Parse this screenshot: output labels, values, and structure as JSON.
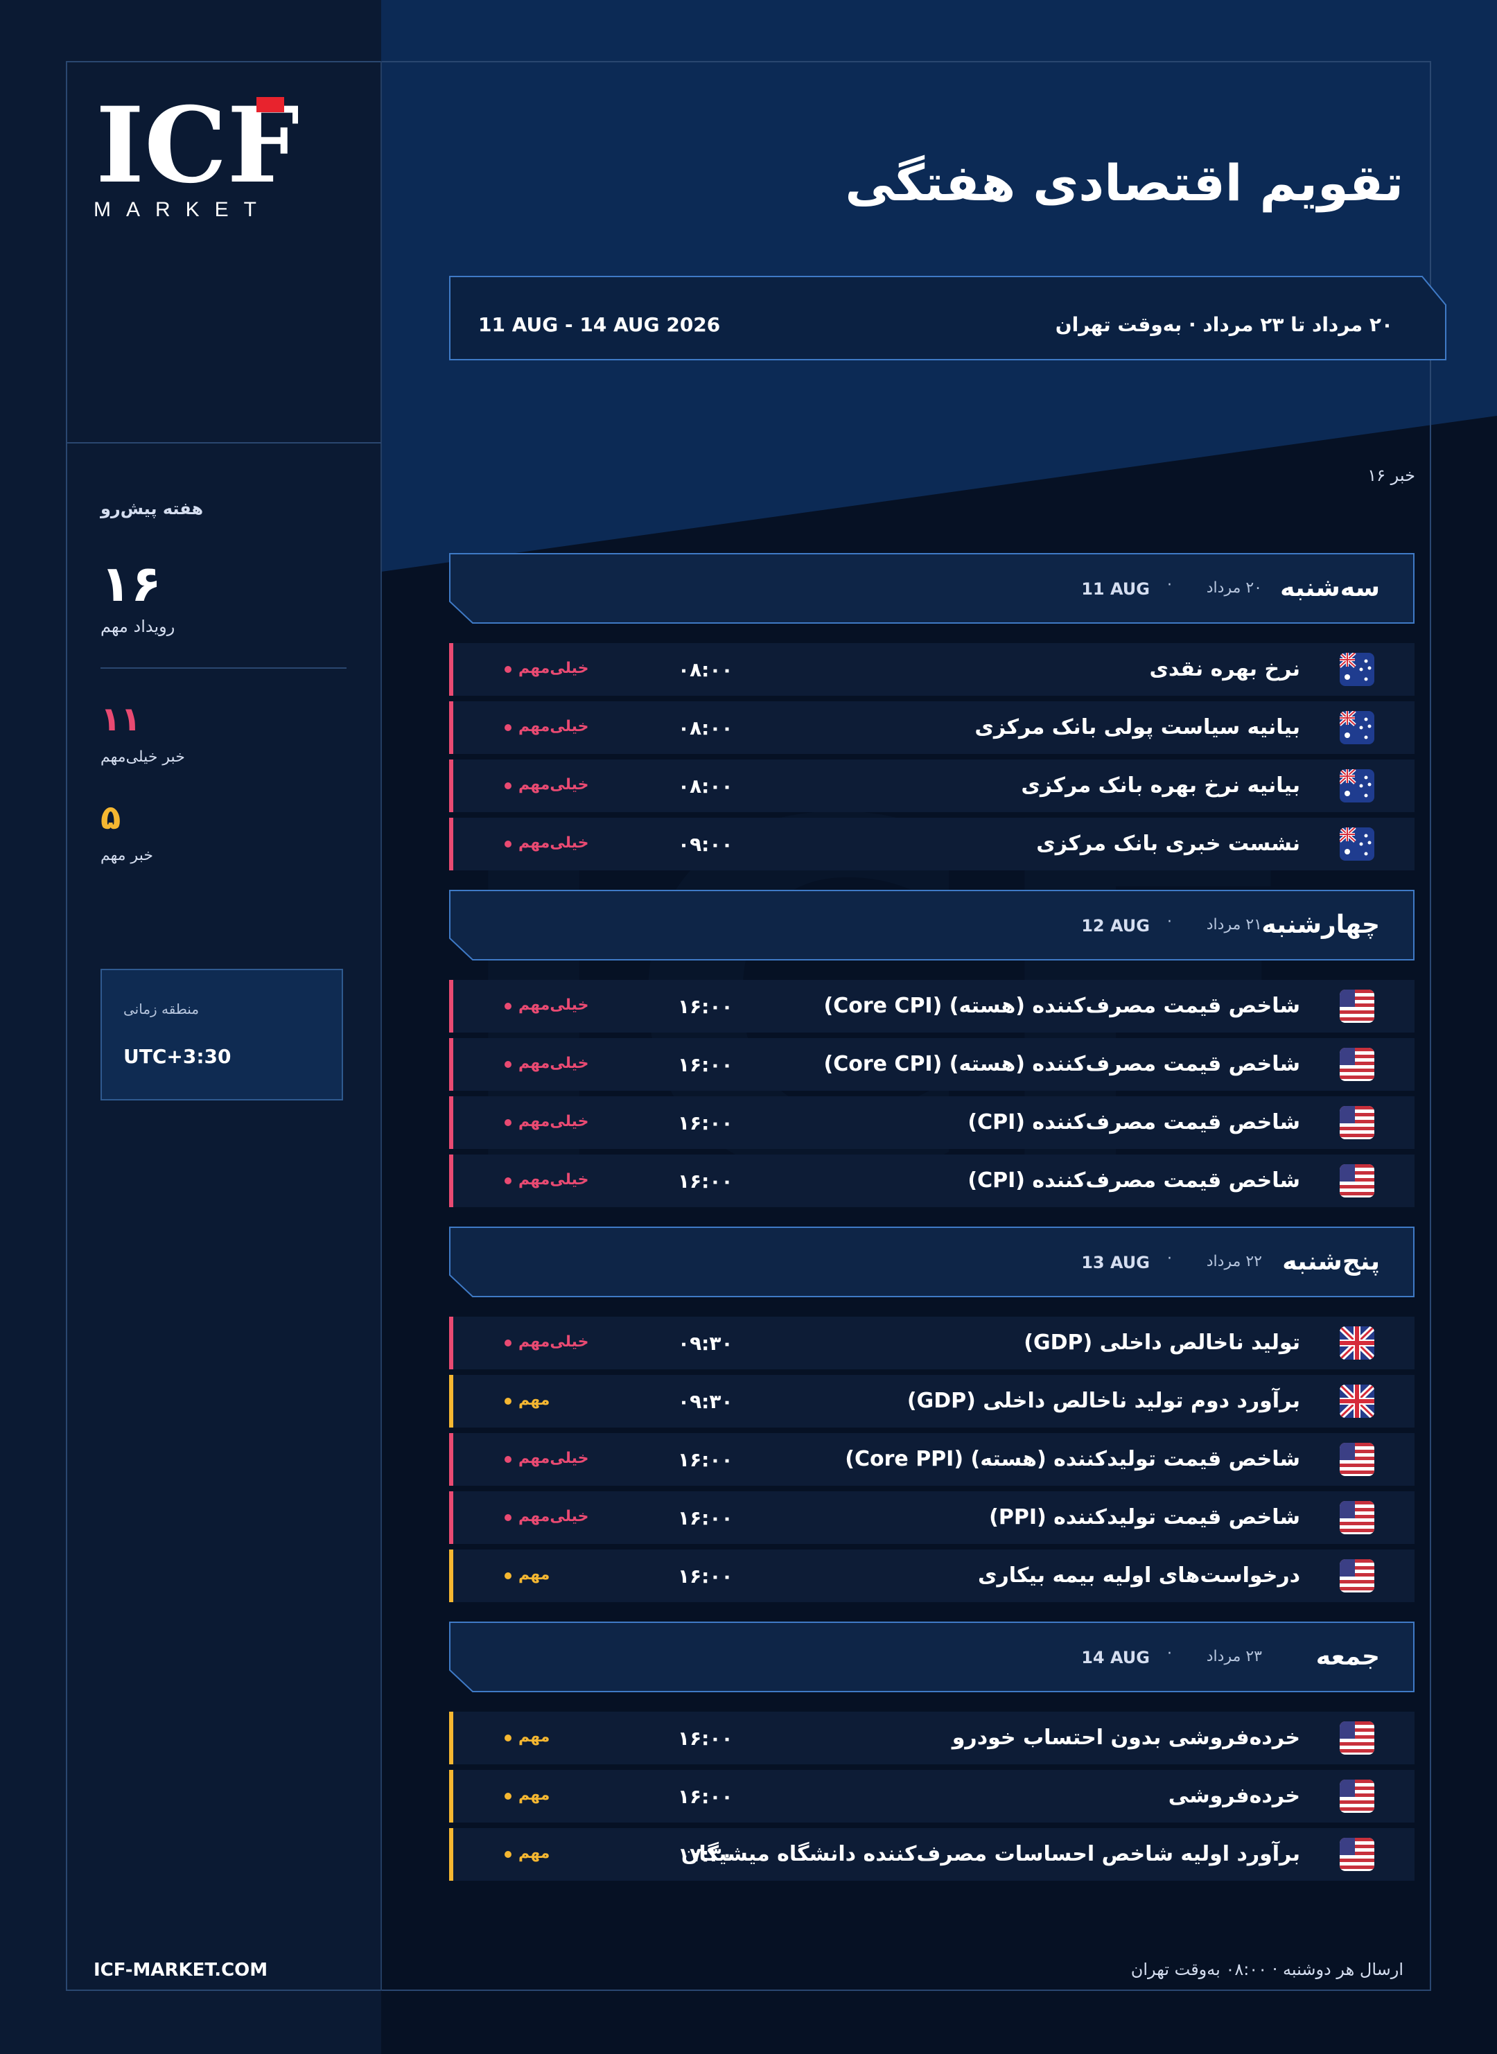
{
  "brand": {
    "logo_text": "ICF",
    "logo_sub": "MARKET",
    "website": "ICF-MARKET.COM"
  },
  "header": {
    "title": "تقویم اقتصادی هفتگی",
    "range_fa": "۲۰ مرداد تا ۲۳ مرداد · به‌وقت تهران",
    "range_en": "11 AUG - 14 AUG 2026",
    "news_count": "خبر ۱۶"
  },
  "sidebar": {
    "week_label": "هفته پیش‌رو",
    "total_count": "۱۶",
    "total_label": "رویداد مهم",
    "very_high_count": "۱۱",
    "very_high_label": "خبر خیلی‌مهم",
    "high_count": "۵",
    "high_label": "خبر مهم",
    "timezone_label": "منطقه زمانی",
    "timezone_value": "UTC+3:30"
  },
  "colors": {
    "very_high": "#e94a72",
    "high": "#f5b731",
    "accent": "#2f5a8f"
  },
  "days": [
    {
      "name": "سه‌شنبه",
      "date_fa": "۲۰ مرداد",
      "date_en": "11 AUG",
      "events": [
        {
          "flag": "au-flag-icon",
          "name": "نرخ بهره نقدی",
          "time": "۰۸:۰۰",
          "importance": "خیلی‌مهم",
          "level": "very_high"
        },
        {
          "flag": "au-flag-icon",
          "name": "بیانیه سیاست پولی بانک مرکزی",
          "time": "۰۸:۰۰",
          "importance": "خیلی‌مهم",
          "level": "very_high"
        },
        {
          "flag": "au-flag-icon",
          "name": "بیانیه نرخ بهره بانک مرکزی",
          "time": "۰۸:۰۰",
          "importance": "خیلی‌مهم",
          "level": "very_high"
        },
        {
          "flag": "au-flag-icon",
          "name": "نشست خبری بانک مرکزی",
          "time": "۰۹:۰۰",
          "importance": "خیلی‌مهم",
          "level": "very_high"
        }
      ]
    },
    {
      "name": "چهارشنبه",
      "date_fa": "۲۱ مرداد",
      "date_en": "12 AUG",
      "events": [
        {
          "flag": "us-flag-icon",
          "name": "شاخص قیمت مصرف‌کننده (هسته)     (Core CPI)",
          "time": "۱۶:۰۰",
          "importance": "خیلی‌مهم",
          "level": "very_high"
        },
        {
          "flag": "us-flag-icon",
          "name": "شاخص قیمت مصرف‌کننده (هسته)     (Core CPI)",
          "time": "۱۶:۰۰",
          "importance": "خیلی‌مهم",
          "level": "very_high"
        },
        {
          "flag": "us-flag-icon",
          "name": "شاخص قیمت مصرف‌کننده     (CPI)",
          "time": "۱۶:۰۰",
          "importance": "خیلی‌مهم",
          "level": "very_high"
        },
        {
          "flag": "us-flag-icon",
          "name": "شاخص قیمت مصرف‌کننده     (CPI)",
          "time": "۱۶:۰۰",
          "importance": "خیلی‌مهم",
          "level": "very_high"
        }
      ]
    },
    {
      "name": "پنج‌شنبه",
      "date_fa": "۲۲ مرداد",
      "date_en": "13 AUG",
      "events": [
        {
          "flag": "uk-flag-icon",
          "name": "تولید ناخالص داخلی      (GDP)",
          "time": "۰۹:۳۰",
          "importance": "خیلی‌مهم",
          "level": "very_high"
        },
        {
          "flag": "uk-flag-icon",
          "name": "برآورد دوم تولید ناخالص داخلی              (GDP)",
          "time": "۰۹:۳۰",
          "importance": "مهم",
          "level": "high"
        },
        {
          "flag": "us-flag-icon",
          "name": "شاخص قیمت تولیدکننده (هسته)     (Core PPI)",
          "time": "۱۶:۰۰",
          "importance": "خیلی‌مهم",
          "level": "very_high"
        },
        {
          "flag": "us-flag-icon",
          "name": "شاخص قیمت تولیدکننده      (PPI)",
          "time": "۱۶:۰۰",
          "importance": "خیلی‌مهم",
          "level": "very_high"
        },
        {
          "flag": "us-flag-icon",
          "name": "درخواست‌های اولیه بیمه بیکاری",
          "time": "۱۶:۰۰",
          "importance": "مهم",
          "level": "high"
        }
      ]
    },
    {
      "name": "جمعه",
      "date_fa": "۲۳ مرداد",
      "date_en": "14 AUG",
      "events": [
        {
          "flag": "us-flag-icon",
          "name": "خرده‌فروشی بدون احتساب خودرو",
          "time": "۱۶:۰۰",
          "importance": "مهم",
          "level": "high"
        },
        {
          "flag": "us-flag-icon",
          "name": "خرده‌فروشی",
          "time": "۱۶:۰۰",
          "importance": "مهم",
          "level": "high"
        },
        {
          "flag": "us-flag-icon",
          "name": "برآورد اولیه شاخص احساسات مصرف‌کننده دانشگاه میشیگان",
          "time": "۱۷:۳۰",
          "importance": "مهم",
          "level": "high"
        }
      ]
    }
  ],
  "footer": {
    "note": "ارسال هر دوشنبه · ۰۸:۰۰ به‌وقت تهران"
  }
}
